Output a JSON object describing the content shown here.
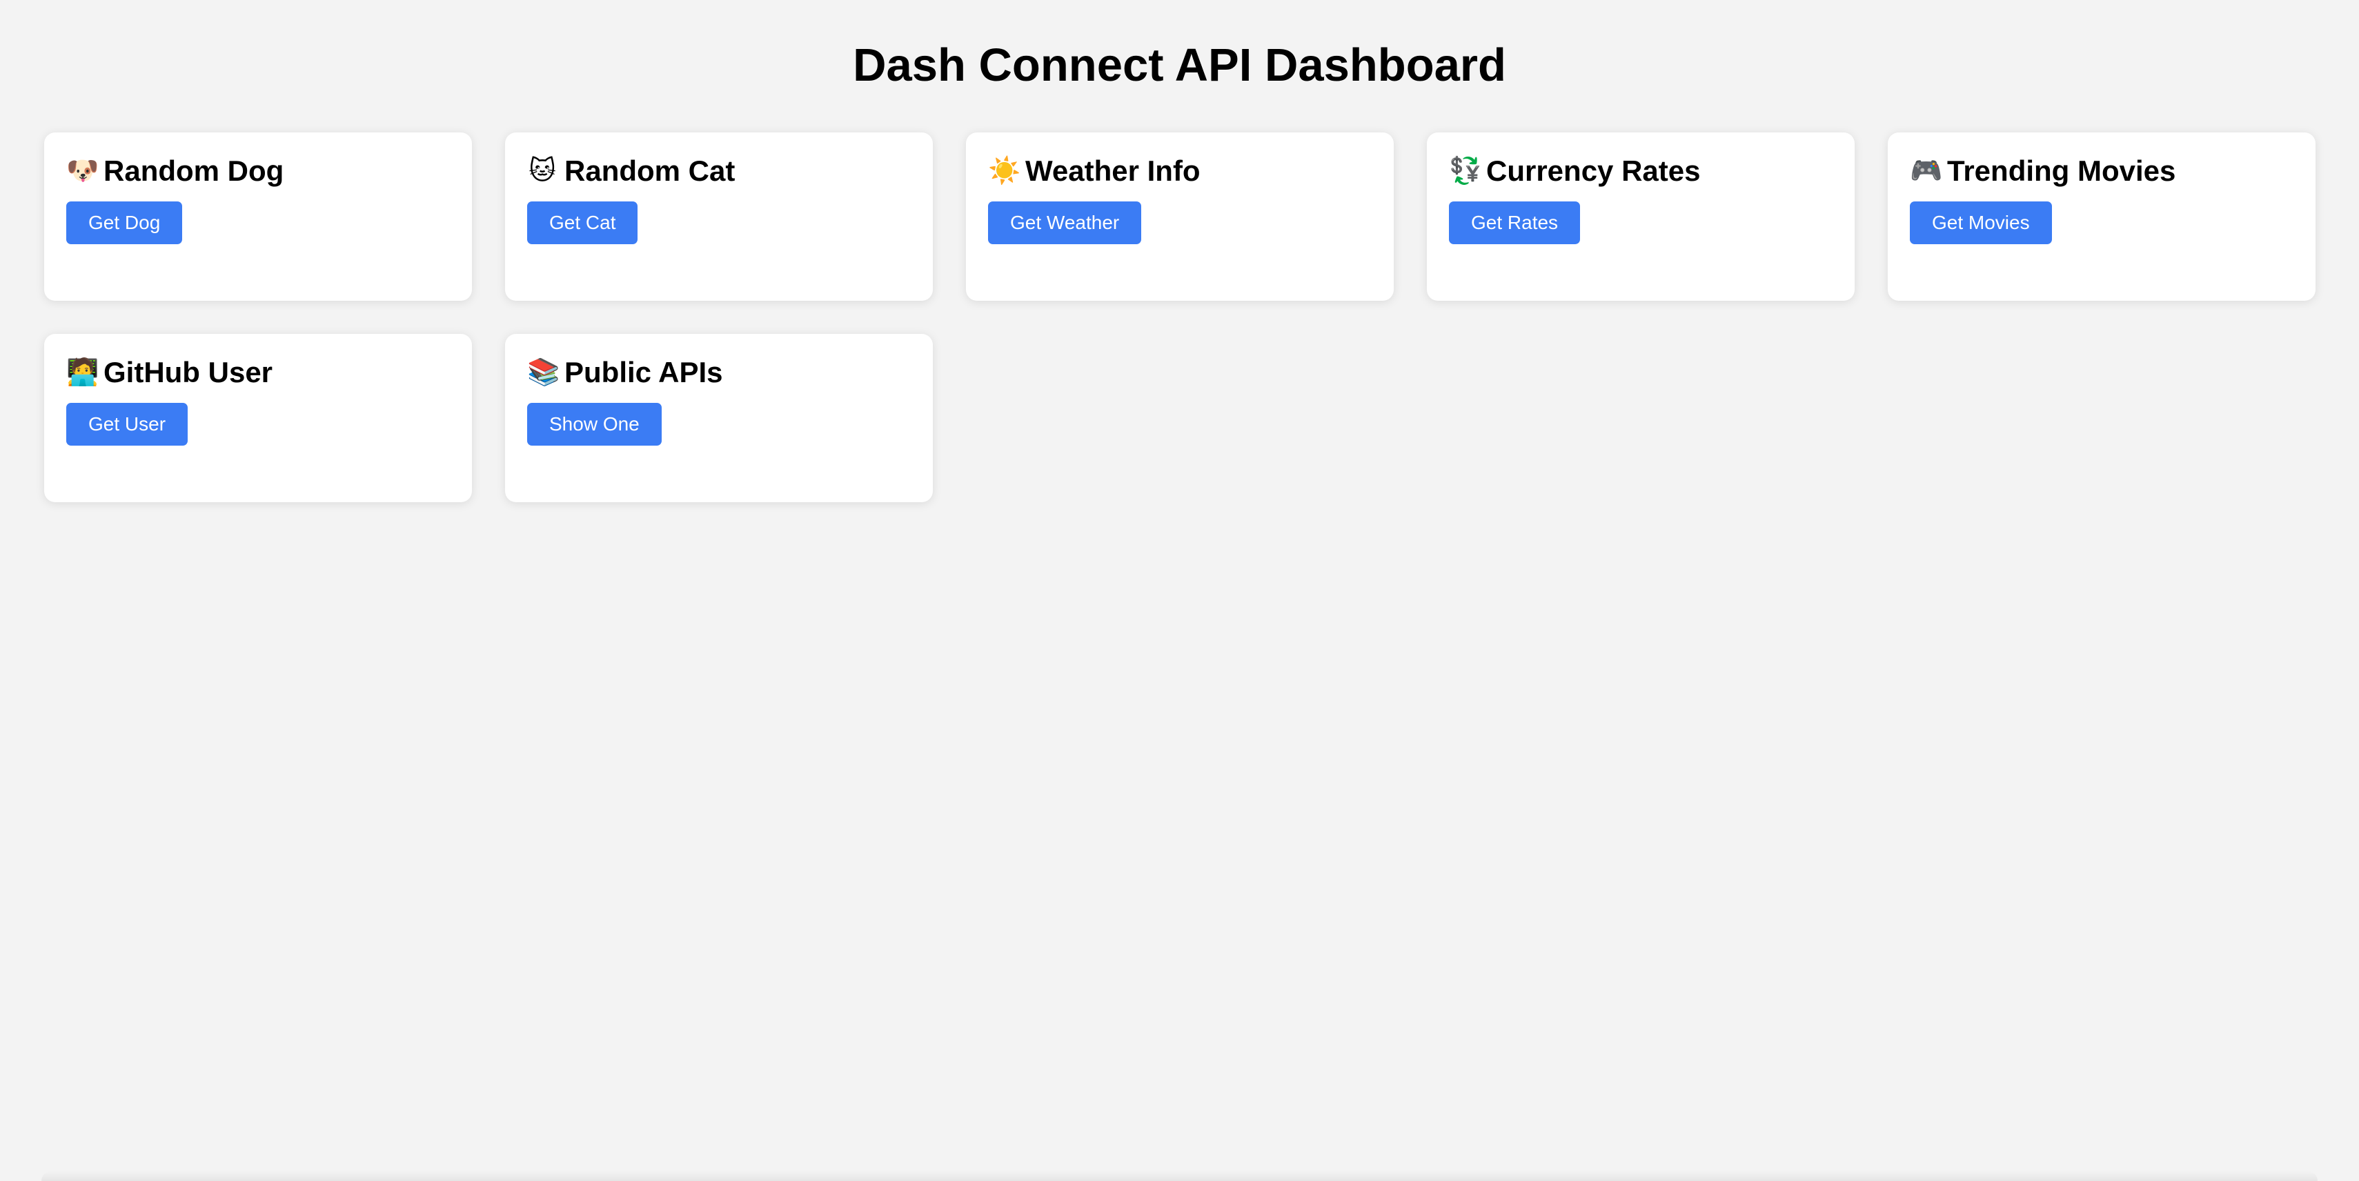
{
  "header": {
    "title": "Dash Connect API Dashboard"
  },
  "cards": [
    {
      "icon": "dog-face-icon",
      "emoji": "🐶",
      "title": "Random Dog",
      "button": "Get Dog"
    },
    {
      "icon": "cat-face-icon",
      "emoji": "🐱",
      "title": "Random Cat",
      "button": "Get Cat"
    },
    {
      "icon": "sun-icon",
      "emoji": "☀️",
      "title": "Weather Info",
      "button": "Get Weather"
    },
    {
      "icon": "currency-exchange-icon",
      "emoji": "💱",
      "title": "Currency Rates",
      "button": "Get Rates"
    },
    {
      "icon": "game-controller-icon",
      "emoji": "🎮",
      "title": "Trending Movies",
      "button": "Get Movies"
    },
    {
      "icon": "technologist-icon",
      "emoji": "🧑‍💻",
      "title": "GitHub User",
      "button": "Get User"
    },
    {
      "icon": "books-icon",
      "emoji": "📚",
      "title": "Public APIs",
      "button": "Show One"
    }
  ],
  "colors": {
    "background": "#f3f3f3",
    "card": "#ffffff",
    "button": "#3b7cf4",
    "button_text": "#ffffff"
  }
}
